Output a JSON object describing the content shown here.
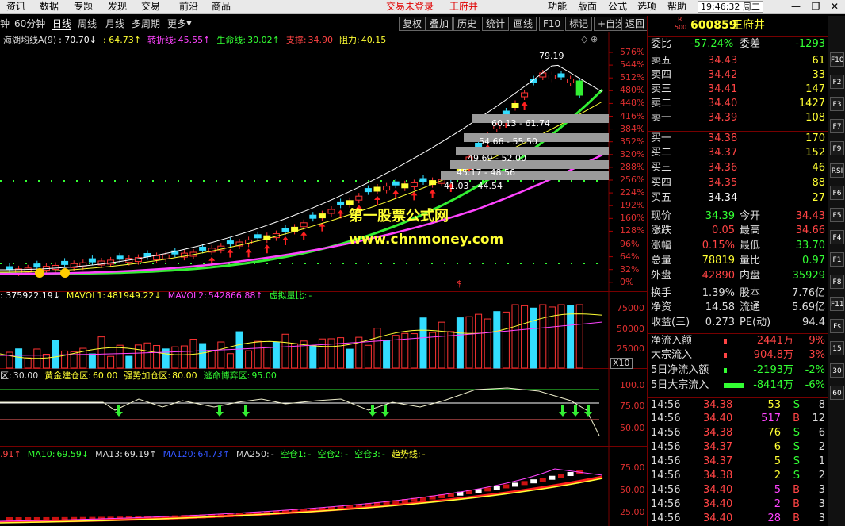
{
  "menubar": {
    "items": [
      "资讯",
      "数据",
      "专题",
      "发现",
      "交易",
      "前沿",
      "商品"
    ],
    "login": "交易未登录",
    "stock_name": "王府井",
    "right_items": [
      "功能",
      "版面",
      "公式",
      "选项",
      "帮助"
    ],
    "clock": "19:46:32 周二"
  },
  "toolbar": {
    "periods": [
      "钟",
      "60分钟",
      "日线",
      "周线",
      "月线",
      "多周期",
      "更多"
    ],
    "active_period": "日线",
    "buttons": [
      "复权",
      "叠加",
      "历史",
      "统计",
      "画线",
      "F10",
      "标记",
      "+自选",
      "返回"
    ]
  },
  "main_chart": {
    "indicator": "海湖均线A(9)",
    "values": [
      {
        "label": "",
        "value": ": 70.70↓",
        "color": "#ffffff"
      },
      {
        "label": "",
        "value": ": 64.73↑",
        "color": "#ffff33"
      },
      {
        "label": "转折线:",
        "value": "45.55↑",
        "color": "#ff44ff"
      },
      {
        "label": "生命线:",
        "value": "30.02↑",
        "color": "#33ff33"
      },
      {
        "label": "支撑:",
        "value": "34.90",
        "color": "#ff4444"
      },
      {
        "label": "阻力:",
        "value": "40.15",
        "color": "#ffff33"
      }
    ],
    "y_ticks": [
      "576%",
      "544%",
      "512%",
      "480%",
      "448%",
      "416%",
      "384%",
      "352%",
      "320%",
      "288%",
      "256%",
      "224%",
      "192%",
      "160%",
      "128%",
      "96%",
      "64%",
      "32%",
      "0%"
    ],
    "annotations": [
      "79.19",
      "60.13 - 61.74",
      "54.66 - 55.50",
      "49.69 - 52.00",
      "45.17 - 48.56",
      "41.03 - 44.54"
    ],
    "watermark1": "第一股票公式网",
    "watermark2": "www.chnmoney.com",
    "dollar": "$"
  },
  "volume_chart": {
    "values": [
      {
        "label": "",
        "value": ": 375922.19↓",
        "color": "#ffffff"
      },
      {
        "label": "MAVOL1:",
        "value": "481949.22↓",
        "color": "#ffff33"
      },
      {
        "label": "MAVOL2:",
        "value": "542866.88↑",
        "color": "#ff44ff"
      },
      {
        "label": "虚拟量比:",
        "value": "-",
        "color": "#33ff33"
      }
    ],
    "y_ticks": [
      "75000",
      "50000",
      "25000"
    ],
    "unit": "X10"
  },
  "osc_chart": {
    "values": [
      {
        "label": "区:",
        "value": "30.00",
        "color": "#dddddd"
      },
      {
        "label": "黄金建仓区:",
        "value": "60.00",
        "color": "#ffff33"
      },
      {
        "label": "强势加仓区:",
        "value": "80.00",
        "color": "#ffff33"
      },
      {
        "label": "逃命博弈区:",
        "value": "95.00",
        "color": "#33ff33"
      }
    ],
    "y_ticks": [
      "100.0",
      "75.00",
      "50.00"
    ]
  },
  "ma_chart": {
    "values": [
      {
        "label": "",
        "value": ".91↑",
        "color": "#ff4444"
      },
      {
        "label": "MA10:",
        "value": "69.59↓",
        "color": "#33ff33"
      },
      {
        "label": "MA13:",
        "value": "69.19↑",
        "color": "#dddddd"
      },
      {
        "label": "MA120:",
        "value": "64.73↑",
        "color": "#3355ff"
      },
      {
        "label": "MA250:",
        "value": "-",
        "color": "#dddddd"
      },
      {
        "label": "空仓1:",
        "value": "-",
        "color": "#33ff33"
      },
      {
        "label": "空仓2:",
        "value": "-",
        "color": "#33ff33"
      },
      {
        "label": "空仓3:",
        "value": "-",
        "color": "#33ff33"
      },
      {
        "label": "趋势线:",
        "value": "-",
        "color": "#ffff33"
      }
    ],
    "y_ticks": [
      "75.00",
      "50.00",
      "25.00"
    ]
  },
  "quote": {
    "code": "600859",
    "name": "王府井",
    "badge_top": "R",
    "badge_bottom": "500",
    "wei_bi_label": "委比",
    "wei_bi": "-57.24%",
    "wei_cha_label": "委差",
    "wei_cha": "-1293",
    "asks": [
      {
        "label": "卖五",
        "price": "34.43",
        "vol": "61"
      },
      {
        "label": "卖四",
        "price": "34.42",
        "vol": "33"
      },
      {
        "label": "卖三",
        "price": "34.41",
        "vol": "147"
      },
      {
        "label": "卖二",
        "price": "34.40",
        "vol": "1427"
      },
      {
        "label": "卖一",
        "price": "34.39",
        "vol": "108"
      }
    ],
    "bids": [
      {
        "label": "买一",
        "price": "34.38",
        "vol": "170"
      },
      {
        "label": "买二",
        "price": "34.37",
        "vol": "152"
      },
      {
        "label": "买三",
        "price": "34.36",
        "vol": "46"
      },
      {
        "label": "买四",
        "price": "34.35",
        "vol": "88"
      },
      {
        "label": "买五",
        "price": "34.34",
        "vol": "27"
      }
    ],
    "stats": [
      {
        "l1": "现价",
        "v1": "34.39",
        "c1": "#33ff33",
        "l2": "今开",
        "v2": "34.43",
        "c2": "#ff4444"
      },
      {
        "l1": "涨跌",
        "v1": "0.05",
        "c1": "#ff4444",
        "l2": "最高",
        "v2": "34.66",
        "c2": "#ff4444"
      },
      {
        "l1": "涨幅",
        "v1": "0.15%",
        "c1": "#ff4444",
        "l2": "最低",
        "v2": "33.70",
        "c2": "#33ff33"
      },
      {
        "l1": "总量",
        "v1": "78819",
        "c1": "#ffff33",
        "l2": "量比",
        "v2": "0.97",
        "c2": "#33ff33"
      },
      {
        "l1": "外盘",
        "v1": "42890",
        "c1": "#ff4444",
        "l2": "内盘",
        "v2": "35929",
        "c2": "#33ff33"
      }
    ],
    "stats2": [
      {
        "l1": "换手",
        "v1": "1.39%",
        "l2": "股本",
        "v2": "7.76亿"
      },
      {
        "l1": "净资",
        "v1": "14.58",
        "l2": "流通",
        "v2": "5.69亿"
      },
      {
        "l1": "收益(三)",
        "v1": "0.273",
        "l2": "PE(动)",
        "v2": "94.4"
      }
    ],
    "flows": [
      {
        "label": "净流入额",
        "value": "2441万",
        "pct": "9%",
        "color": "#ff4444"
      },
      {
        "label": "大宗流入",
        "value": "904.8万",
        "pct": "3%",
        "color": "#ff4444"
      },
      {
        "label": "5日净流入额",
        "value": "-2193万",
        "pct": "-2%",
        "color": "#33ff33"
      },
      {
        "label": "5日大宗流入",
        "value": "-8414万",
        "pct": "-6%",
        "color": "#33ff33"
      }
    ],
    "ticks": [
      {
        "time": "14:56",
        "price": "34.38",
        "vol": "53",
        "side": "S",
        "n": "8"
      },
      {
        "time": "14:56",
        "price": "34.40",
        "vol": "517",
        "side": "B",
        "n": "12"
      },
      {
        "time": "14:56",
        "price": "34.38",
        "vol": "76",
        "side": "S",
        "n": "6"
      },
      {
        "time": "14:56",
        "price": "34.37",
        "vol": "6",
        "side": "S",
        "n": "2"
      },
      {
        "time": "14:56",
        "price": "34.37",
        "vol": "5",
        "side": "S",
        "n": "1"
      },
      {
        "time": "14:56",
        "price": "34.38",
        "vol": "2",
        "side": "S",
        "n": "2"
      },
      {
        "time": "14:56",
        "price": "34.40",
        "vol": "5",
        "side": "B",
        "n": "3"
      },
      {
        "time": "14:56",
        "price": "34.40",
        "vol": "2",
        "side": "B",
        "n": "3"
      },
      {
        "time": "14:56",
        "price": "34.40",
        "vol": "28",
        "side": "B",
        "n": "3"
      }
    ]
  },
  "sidebar_buttons": [
    "F10",
    "F2",
    "F3",
    "F7",
    "F9",
    "RSI",
    "F6",
    "F5",
    "F4",
    "F1",
    "F8",
    "F11",
    "Fs",
    "15",
    "30",
    "60"
  ]
}
